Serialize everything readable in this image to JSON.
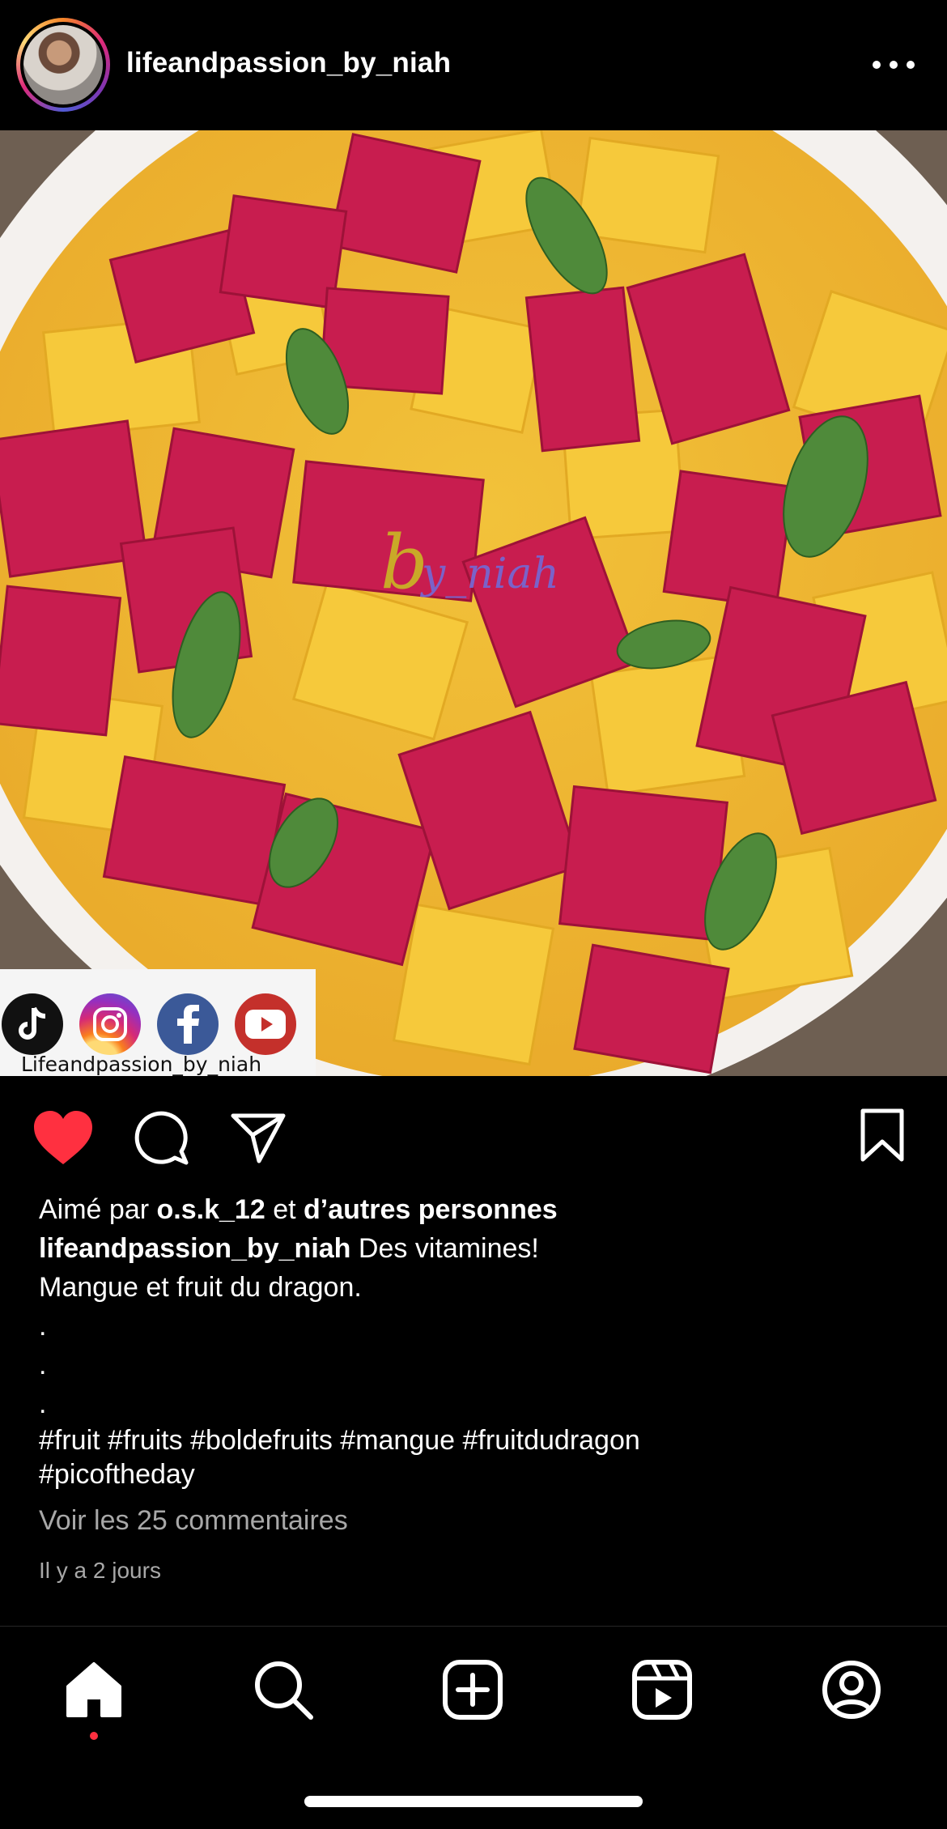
{
  "post": {
    "username": "lifeandpassion_by_niah",
    "image_overlay_label": "Lifeandpassion_by_niah",
    "watermark_b": "b",
    "watermark_text": "y_niah"
  },
  "likes": {
    "prefix": "Aimé par",
    "user": "o.s.k_12",
    "conj": "et",
    "others": "d’autres personnes"
  },
  "caption": {
    "author": "lifeandpassion_by_niah",
    "line1": "Des vitamines!",
    "line2": "Mangue et fruit du dragon.",
    "dot1": ".",
    "dot2": ".",
    "dot3": ".",
    "hashtags_line1": "#fruit #fruits #boldefruits #mangue #fruitdudragon",
    "hashtags_line2": "#picoftheday"
  },
  "comments_link": "Voir les 25 commentaires",
  "timestamp": "Il y a 2 jours",
  "state": {
    "liked": true,
    "active_tab": "home"
  },
  "colors": {
    "like_red": "#ff3040",
    "muted": "#a8a8a8",
    "background": "#000000"
  },
  "icons": [
    "more-icon",
    "heart-icon",
    "comment-icon",
    "share-icon",
    "bookmark-icon",
    "home-icon",
    "search-icon",
    "create-icon",
    "reels-icon",
    "profile-icon",
    "tiktok-icon",
    "instagram-icon",
    "facebook-icon",
    "youtube-icon"
  ]
}
